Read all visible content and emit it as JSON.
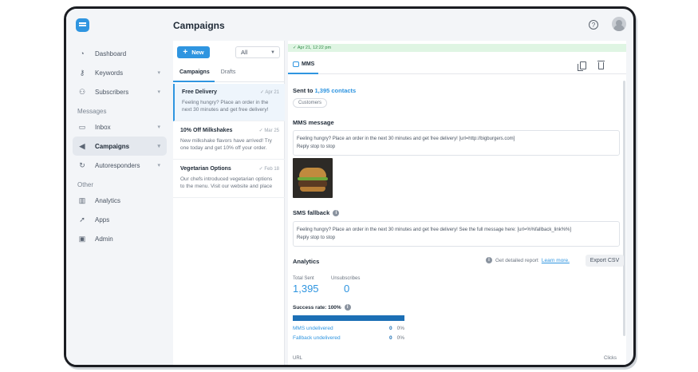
{
  "sidebar": {
    "items": [
      {
        "label": "Dashboard",
        "icon": "gauge-icon"
      },
      {
        "label": "Keywords",
        "icon": "key-icon"
      },
      {
        "label": "Subscribers",
        "icon": "users-icon"
      }
    ],
    "section_messages": "Messages",
    "message_items": [
      {
        "label": "Inbox",
        "icon": "chat-icon"
      },
      {
        "label": "Campaigns",
        "icon": "megaphone-icon",
        "active": true
      },
      {
        "label": "Autoresponders",
        "icon": "repeat-icon"
      }
    ],
    "section_other": "Other",
    "other_items": [
      {
        "label": "Analytics",
        "icon": "chart-icon"
      },
      {
        "label": "Apps",
        "icon": "rocket-icon"
      },
      {
        "label": "Admin",
        "icon": "admin-icon"
      }
    ]
  },
  "header": {
    "title": "Campaigns",
    "help_symbol": "?"
  },
  "list": {
    "new_label": "New",
    "filter_value": "All",
    "tabs": [
      "Campaigns",
      "Drafts"
    ],
    "campaigns": [
      {
        "name": "Free Delivery",
        "date": "Apr 21",
        "preview_1": "Feeling hungry? Place an order in the",
        "preview_2": "next 30 minutes and get free delivery!"
      },
      {
        "name": "10% Off Milkshakes",
        "date": "Mar 25",
        "preview_1": "New milkshake flavors have arrived! Try",
        "preview_2": "one today and get 10% off your order."
      },
      {
        "name": "Vegetarian Options",
        "date": "Feb 18",
        "preview_1": "Our chefs introduced vegetarian options",
        "preview_2": "to the menu. Visit our website and place"
      }
    ]
  },
  "detail": {
    "status": "Apr 21, 12:22 pm",
    "type_label": "MMS",
    "sent_prefix": "Sent to",
    "sent_count": "1,395 contacts",
    "audience_tag": "Customers",
    "mms_title": "MMS message",
    "mms_line_1": "Feeling hungry? Place an order in the next 30 minutes and get free delivery! [url=http://bigburgers.com]",
    "mms_line_2": "Reply stop to stop",
    "sms_title": "SMS fallback",
    "sms_line_1": "Feeling hungry? Place an order in the next 30 minutes and get free delivery! See the full message here: [url=%%fallback_link%%]",
    "sms_line_2": "Reply stop to stop",
    "analytics_title": "Analytics",
    "report_hint": "Get detailed report",
    "learn_more": "Learn more.",
    "export_label": "Export CSV",
    "total_sent_label": "Total Sent",
    "total_sent_value": "1,395",
    "unsub_label": "Unsubscribes",
    "unsub_value": "0",
    "success_rate": "Success rate: 100%",
    "success_fraction": 1.0,
    "mms_undelivered_label": "MMS undelivered",
    "mms_undelivered_count": "0",
    "mms_undelivered_pct": "0%",
    "fallback_undelivered_label": "Fallback undelivered",
    "fallback_undelivered_count": "0",
    "fallback_undelivered_pct": "0%",
    "url_head": "URL",
    "clicks_head": "Clicks"
  },
  "colors": {
    "accent": "#2f95e0",
    "status_bg": "#dff5e3",
    "status_text": "#2e8a46"
  }
}
